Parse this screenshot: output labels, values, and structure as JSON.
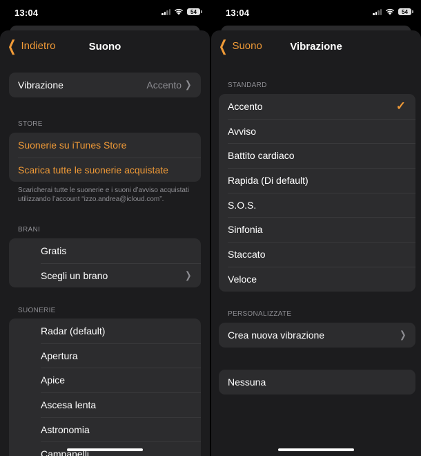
{
  "status": {
    "time": "13:04",
    "battery": "54"
  },
  "left": {
    "back_label": "Indietro",
    "title": "Suono",
    "vibration_row": {
      "label": "Vibrazione",
      "value": "Accento"
    },
    "store_header": "STORE",
    "store_items": [
      "Suonerie su iTunes Store",
      "Scarica tutte le suonerie acquistate"
    ],
    "store_footnote": "Scaricherai tutte le suonerie e i suoni d’avviso acquistati utilizzando l’account “izzo.andrea@icloud.com”.",
    "brani_header": "BRANI",
    "brani_items": [
      "Gratis",
      "Scegli un brano"
    ],
    "suonerie_header": "SUONERIE",
    "suonerie_items": [
      "Radar (default)",
      "Apertura",
      "Apice",
      "Ascesa lenta",
      "Astronomia",
      "Campanelli"
    ]
  },
  "right": {
    "back_label": "Suono",
    "title": "Vibrazione",
    "standard_header": "STANDARD",
    "standard_items": [
      "Accento",
      "Avviso",
      "Battito cardiaco",
      "Rapida (Di default)",
      "S.O.S.",
      "Sinfonia",
      "Staccato",
      "Veloce"
    ],
    "selected_index": 0,
    "custom_header": "PERSONALIZZATE",
    "custom_item": "Crea nuova vibrazione",
    "none_item": "Nessuna"
  },
  "colors": {
    "accent": "#f09a37",
    "background": "#1c1c1e",
    "cell": "#2c2c2e",
    "secondary_text": "#8e8e93"
  }
}
